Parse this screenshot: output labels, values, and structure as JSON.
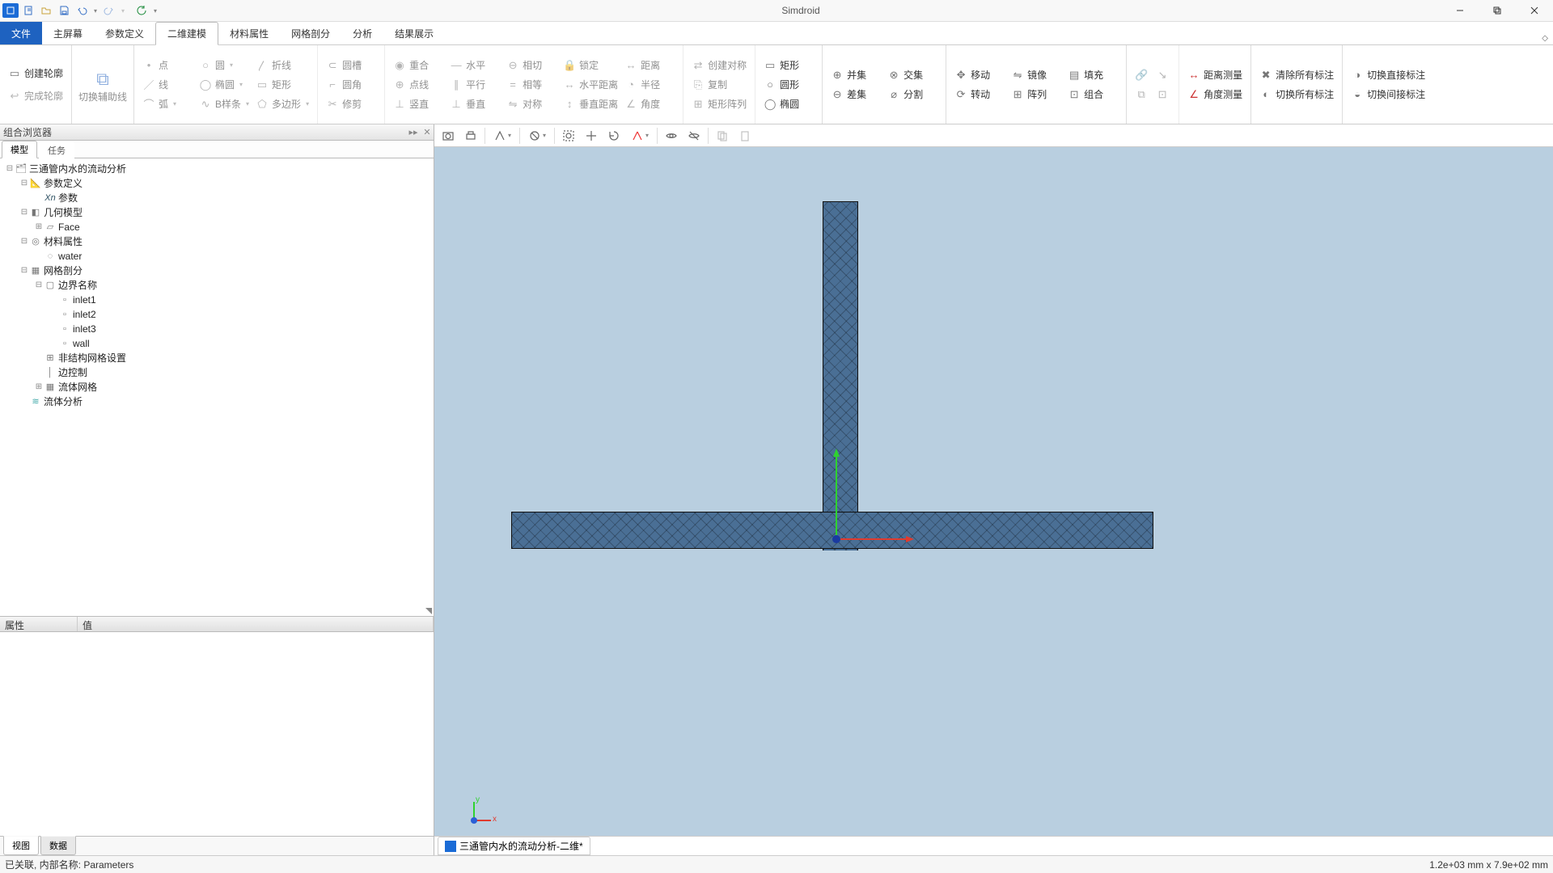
{
  "app": {
    "title": "Simdroid"
  },
  "menu": {
    "file": "文件",
    "tabs": [
      "主屏幕",
      "参数定义",
      "二维建模",
      "材料属性",
      "网格剖分",
      "分析",
      "结果展示"
    ],
    "activeIndex": 2
  },
  "ribbon": {
    "g1": {
      "createProfile": "创建轮廓",
      "finishProfile": "完成轮廓"
    },
    "g2": {
      "auxLine": "切换辅助线"
    },
    "g3": {
      "point": "点",
      "circle": "圆",
      "polyline": "折线",
      "line": "线",
      "ellipse": "椭圆",
      "rect": "矩形",
      "arc": "弧",
      "bspline": "B样条",
      "polygon": "多边形"
    },
    "g4": {
      "slot": "圆槽",
      "fillet": "圆角",
      "trim": "修剪"
    },
    "g5": {
      "coincident": "重合",
      "pointOnLine": "点线",
      "vertical": "竖直"
    },
    "g6": {
      "horizontal": "水平",
      "parallel": "平行",
      "perpendicular": "垂直"
    },
    "g7": {
      "tangent": "相切",
      "equal": "相等",
      "symmetric": "对称"
    },
    "g8": {
      "lock": "锁定",
      "horizDist": "水平距离",
      "vertDist": "垂直距离"
    },
    "g9": {
      "distance": "距离",
      "radius": "半径",
      "angle": "角度"
    },
    "g10": {
      "createSym": "创建对称",
      "copy": "复制",
      "rectArray": "矩形阵列"
    },
    "g11": {
      "rectShape": "矩形",
      "circleShape": "圆形",
      "ellipseShape": "椭圆"
    },
    "g12": {
      "union": "并集",
      "intersect": "交集",
      "diff": "差集",
      "split": "分割"
    },
    "g13": {
      "move": "移动",
      "rotate": "转动"
    },
    "g14": {
      "mirror": "镜像",
      "array": "阵列"
    },
    "g15": {
      "fill": "填充",
      "group": "组合"
    },
    "g16": {
      "distMeasure": "距离测量",
      "angleMeasure": "角度测量"
    },
    "g17": {
      "clearAll": "清除所有标注",
      "toggleAll": "切换所有标注"
    },
    "g18": {
      "toggleDirect": "切换直接标注",
      "toggleIndirect": "切换间接标注"
    }
  },
  "browser": {
    "panelTitle": "组合浏览器",
    "tabs": {
      "model": "模型",
      "task": "任务"
    },
    "root": "三通管内水的流动分析",
    "paramDef": "参数定义",
    "params": "参数",
    "geomModel": "几何模型",
    "face": "Face",
    "material": "材料属性",
    "water": "water",
    "meshDiv": "网格剖分",
    "bndName": "边界名称",
    "inlet1": "inlet1",
    "inlet2": "inlet2",
    "inlet3": "inlet3",
    "wall": "wall",
    "unstruct": "非结构网格设置",
    "edgeCtrl": "边控制",
    "fluidMesh": "流体网格",
    "fluidAnalysis": "流体分析"
  },
  "props": {
    "attr": "属性",
    "val": "值"
  },
  "bottomTabs": {
    "view": "视图",
    "data": "数据"
  },
  "docTab": "三通管内水的流动分析-二维*",
  "triad": {
    "x": "x",
    "y": "y"
  },
  "status": {
    "left": "已关联, 内部名称: Parameters",
    "right": "1.2e+03 mm x 7.9e+02 mm"
  }
}
